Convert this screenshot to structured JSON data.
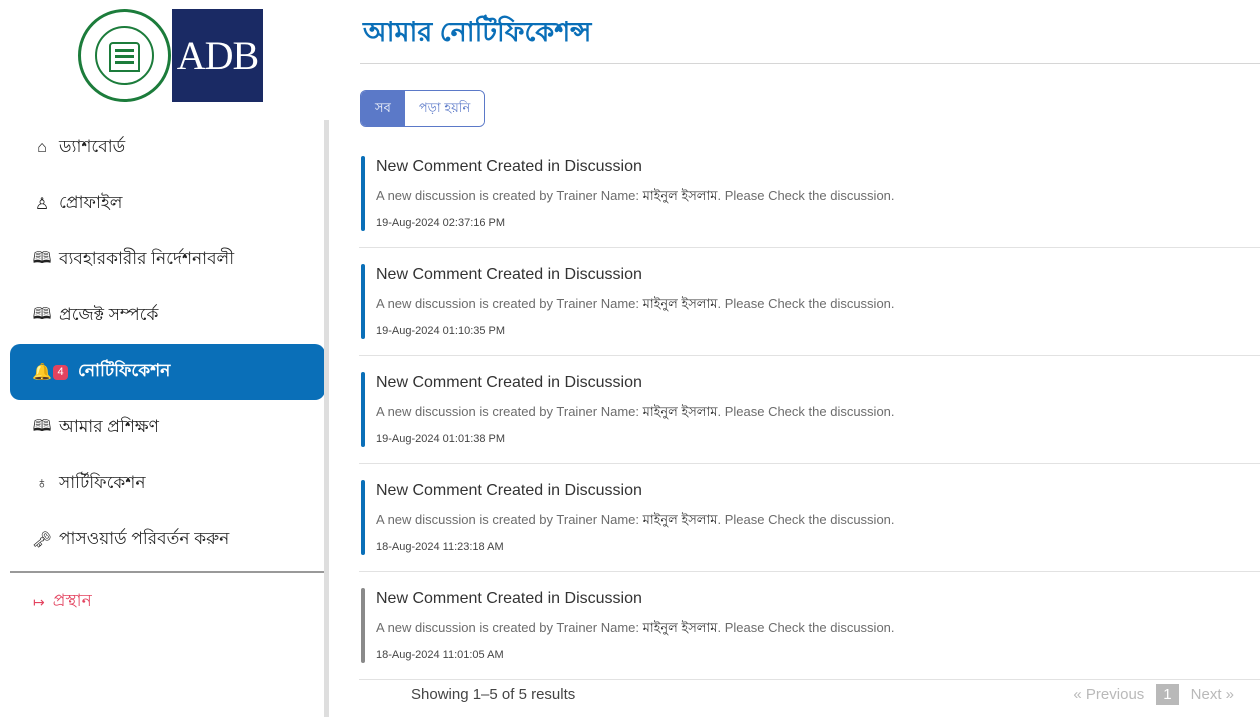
{
  "sidebar": {
    "logo_adb": "ADB",
    "items": [
      {
        "icon": "home-icon",
        "glyph": "⌂",
        "label": "ড্যাশবোর্ড"
      },
      {
        "icon": "user-icon",
        "glyph": "♙",
        "label": "প্রোফাইল"
      },
      {
        "icon": "book-icon",
        "glyph": "🕮",
        "label": "ব্যবহারকারীর নির্দেশনাবলী"
      },
      {
        "icon": "book-icon",
        "glyph": "🕮",
        "label": "প্রজেক্ট সম্পর্কে"
      },
      {
        "icon": "bell-icon",
        "glyph": "🔔",
        "label": "নোটিফিকেশন",
        "badge": "4",
        "active": true
      },
      {
        "icon": "book-icon",
        "glyph": "🕮",
        "label": "আমার প্রশিক্ষণ"
      },
      {
        "icon": "award-icon",
        "glyph": "♁",
        "label": "সার্টিফিকেশন"
      },
      {
        "icon": "key-icon",
        "glyph": "🗝",
        "label": "পাসওয়ার্ড পরিবর্তন করুন"
      }
    ],
    "logout": {
      "icon": "logout-icon",
      "glyph": "↦",
      "label": "প্রস্থান"
    }
  },
  "main": {
    "title": "আমার নোটিফিকেশন্স",
    "filters": [
      {
        "label": "সব",
        "active": true
      },
      {
        "label": "পড়া হয়নি",
        "active": false
      }
    ],
    "notifications": [
      {
        "title": "New Comment Created in Discussion",
        "body_prefix": "A new discussion is created by Trainer Name:",
        "trainer": "মাইনুল ইসলাম",
        "body_suffix": ". Please Check the discussion.",
        "time": "19-Aug-2024 02:37:16 PM",
        "read": false
      },
      {
        "title": "New Comment Created in Discussion",
        "body_prefix": "A new discussion is created by Trainer Name:",
        "trainer": "মাইনুল ইসলাম",
        "body_suffix": ". Please Check the discussion.",
        "time": "19-Aug-2024 01:10:35 PM",
        "read": false
      },
      {
        "title": "New Comment Created in Discussion",
        "body_prefix": "A new discussion is created by Trainer Name:",
        "trainer": "মাইনুল ইসলাম",
        "body_suffix": ". Please Check the discussion.",
        "time": "19-Aug-2024 01:01:38 PM",
        "read": false
      },
      {
        "title": "New Comment Created in Discussion",
        "body_prefix": "A new discussion is created by Trainer Name:",
        "trainer": "মাইনুল ইসলাম",
        "body_suffix": ". Please Check the discussion.",
        "time": "18-Aug-2024 11:23:18 AM",
        "read": false
      },
      {
        "title": "New Comment Created in Discussion",
        "body_prefix": "A new discussion is created by Trainer Name:",
        "trainer": "মাইনুল ইসলাম",
        "body_suffix": ". Please Check the discussion.",
        "time": "18-Aug-2024 11:01:05 AM",
        "read": true
      }
    ],
    "results_text": "Showing 1–5 of 5 results",
    "pagination": {
      "previous": "« Previous",
      "current": "1",
      "next": "Next »"
    }
  },
  "colors": {
    "primary": "#0a6fb8",
    "filter_accent": "#5b79c8",
    "badge": "#e3435f",
    "read_bar": "#8a8a8a"
  }
}
